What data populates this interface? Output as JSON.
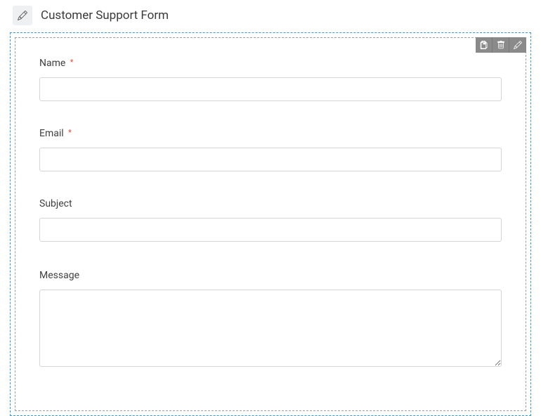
{
  "header": {
    "title": "Customer Support Form"
  },
  "toolbar": {
    "copy_icon": "copy-icon",
    "delete_icon": "trash-icon",
    "edit_icon": "pencil-icon"
  },
  "fields": {
    "name": {
      "label": "Name",
      "required": true,
      "value": ""
    },
    "email": {
      "label": "Email",
      "required": true,
      "value": ""
    },
    "subject": {
      "label": "Subject",
      "required": false,
      "value": ""
    },
    "message": {
      "label": "Message",
      "required": false,
      "value": ""
    }
  },
  "symbols": {
    "required": "*"
  }
}
